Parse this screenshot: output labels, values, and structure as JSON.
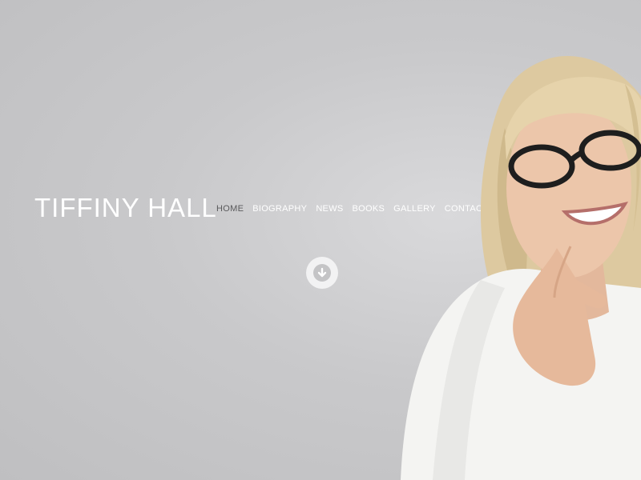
{
  "header": {
    "site_title": "TIFFINY HALL"
  },
  "nav": {
    "items": [
      {
        "label": "HOME",
        "active": true
      },
      {
        "label": "BIOGRAPHY",
        "active": false
      },
      {
        "label": "NEWS",
        "active": false
      },
      {
        "label": "BOOKS",
        "active": false
      },
      {
        "label": "GALLERY",
        "active": false
      },
      {
        "label": "CONTACT",
        "active": false
      }
    ]
  },
  "hero": {
    "scroll_icon": "arrow-down-circle-icon",
    "portrait": "woman-with-glasses-portrait"
  },
  "colors": {
    "background": "#c9c9cb",
    "title_text": "#ffffff",
    "nav_text": "#ffffff",
    "nav_active_text": "#5a5a5c",
    "jacket": "#f4f4f2",
    "hair": "#e0cfa6",
    "skin": "#e9c1a5"
  }
}
